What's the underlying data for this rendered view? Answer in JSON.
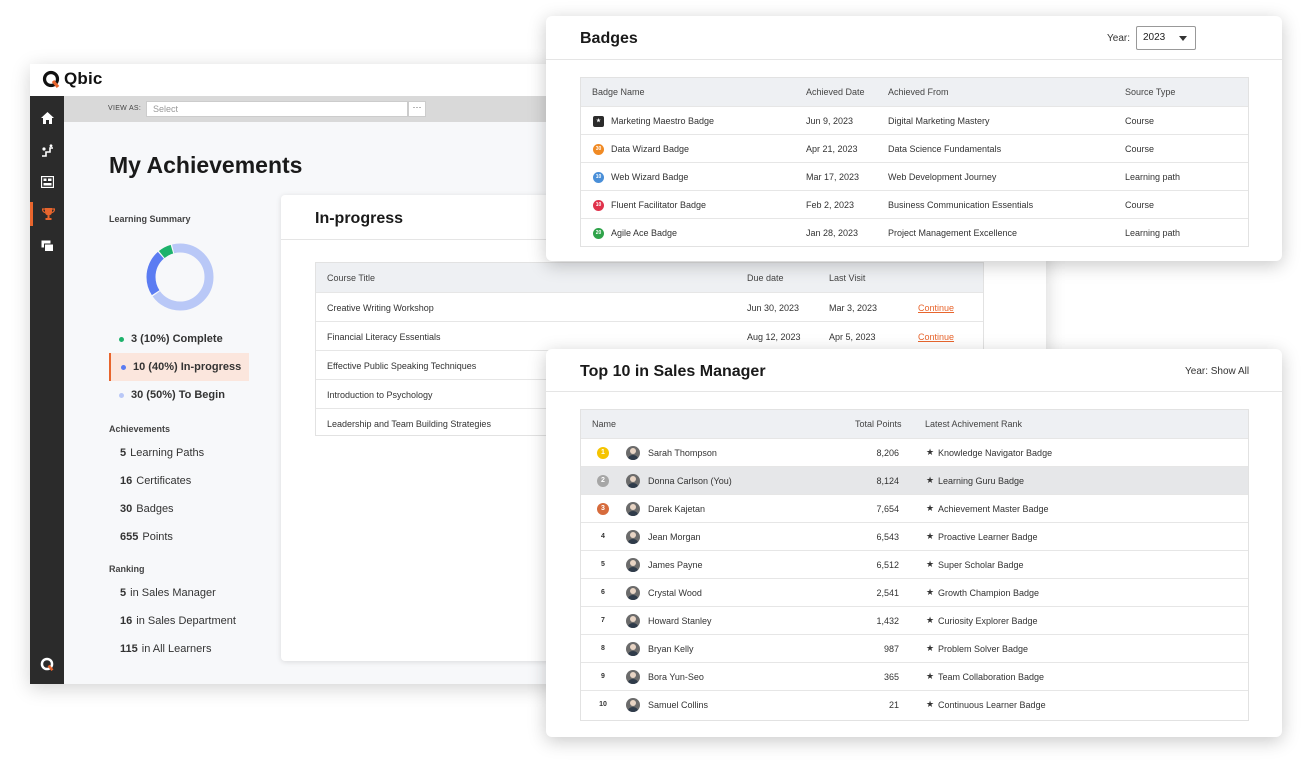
{
  "app": {
    "name": "Qbic"
  },
  "view_as": {
    "label": "VIEW AS:",
    "placeholder": "Select",
    "more": "···"
  },
  "page_title": "My Achievements",
  "summary": {
    "heading": "Learning Summary",
    "donut": [
      {
        "label": "Complete",
        "value": 3,
        "percent": "10%",
        "color": "#1db26b"
      },
      {
        "label": "In-progress",
        "value": 10,
        "percent": "40%",
        "color": "#5b7cf2"
      },
      {
        "label": "To Begin",
        "value": 30,
        "percent": "50%",
        "color": "#b9c8f7"
      }
    ],
    "legend": [
      {
        "text": "3 (10%)  Complete"
      },
      {
        "text": "10 (40%)  In-progress"
      },
      {
        "text": "30 (50%)  To Begin"
      }
    ]
  },
  "achievements": {
    "heading": "Achievements",
    "items": [
      {
        "num": "5",
        "label": "Learning Paths"
      },
      {
        "num": "16",
        "label": "Certificates"
      },
      {
        "num": "30",
        "label": "Badges"
      },
      {
        "num": "655",
        "label": "Points"
      }
    ]
  },
  "ranking": {
    "heading": "Ranking",
    "items": [
      {
        "num": "5",
        "label": "in Sales Manager"
      },
      {
        "num": "16",
        "label": "in Sales Department"
      },
      {
        "num": "115",
        "label": "in All Learners"
      }
    ]
  },
  "inprogress": {
    "title": "In-progress",
    "headers": [
      "Course Title",
      "Due date",
      "Last Visit"
    ],
    "rows": [
      {
        "title": "Creative Writing Workshop",
        "due": "Jun 30, 2023",
        "visit": "Mar 3, 2023",
        "action": "Continue"
      },
      {
        "title": "Financial Literacy Essentials",
        "due": "Aug 12, 2023",
        "visit": "Apr 5, 2023",
        "action": "Continue"
      },
      {
        "title": "Effective Public Speaking Techniques",
        "due": "",
        "visit": "",
        "action": ""
      },
      {
        "title": "Introduction to Psychology",
        "due": "",
        "visit": "",
        "action": ""
      },
      {
        "title": "Leadership and Team Building Strategies",
        "due": "",
        "visit": "",
        "action": ""
      }
    ]
  },
  "badges": {
    "title": "Badges",
    "year_label": "Year:",
    "year_value": "2023",
    "headers": [
      "Badge Name",
      "Achieved Date",
      "Achieved From",
      "Source Type"
    ],
    "rows": [
      {
        "icon": "star-badge",
        "color": "#2b2b2b",
        "mark": "★",
        "name": "Marketing Maestro Badge",
        "date": "Jun 9, 2023",
        "from": "Digital Marketing Mastery",
        "type": "Course"
      },
      {
        "icon": "30-badge",
        "color": "#f08a24",
        "mark": "30",
        "name": "Data Wizard Badge",
        "date": "Apr 21, 2023",
        "from": "Data Science Fundamentals",
        "type": "Course"
      },
      {
        "icon": "10-badge",
        "color": "#4a8fd8",
        "mark": "10",
        "name": "Web Wizard Badge",
        "date": "Mar 17, 2023",
        "from": "Web Development Journey",
        "type": "Learning path"
      },
      {
        "icon": "10-badge",
        "color": "#e0324b",
        "mark": "10",
        "name": "Fluent Facilitator Badge",
        "date": "Feb 2, 2023",
        "from": "Business Communication Essentials",
        "type": "Course"
      },
      {
        "icon": "20-badge",
        "color": "#2fa34a",
        "mark": "20",
        "name": "Agile Ace Badge",
        "date": "Jan 28, 2023",
        "from": "Project Management Excellence",
        "type": "Learning path"
      }
    ]
  },
  "top10": {
    "title": "Top 10 in Sales Manager",
    "year_text": "Year: Show All",
    "headers": [
      "Name",
      "Total Points",
      "Latest Achivement Rank"
    ],
    "rows": [
      {
        "rank": "1",
        "medal": "#f5c400",
        "name": "Sarah Thompson",
        "points": "8,206",
        "badge": "Knowledge Navigator Badge"
      },
      {
        "rank": "2",
        "medal": "#a6a6a6",
        "name": "Donna Carlson (You)",
        "points": "8,124",
        "badge": "Learning Guru Badge",
        "highlight": true
      },
      {
        "rank": "3",
        "medal": "#d66b3c",
        "name": "Darek Kajetan",
        "points": "7,654",
        "badge": "Achievement Master Badge"
      },
      {
        "rank": "4",
        "name": "Jean Morgan",
        "points": "6,543",
        "badge": "Proactive Learner Badge"
      },
      {
        "rank": "5",
        "name": "James Payne",
        "points": "6,512",
        "badge": "Super Scholar Badge"
      },
      {
        "rank": "6",
        "name": "Crystal Wood",
        "points": "2,541",
        "badge": "Growth Champion Badge"
      },
      {
        "rank": "7",
        "name": "Howard Stanley",
        "points": "1,432",
        "badge": "Curiosity Explorer Badge"
      },
      {
        "rank": "8",
        "name": "Bryan Kelly",
        "points": "987",
        "badge": "Problem Solver Badge"
      },
      {
        "rank": "9",
        "name": "Bora Yun-Seo",
        "points": "365",
        "badge": "Team Collaboration Badge"
      },
      {
        "rank": "10",
        "name": "Samuel Collins",
        "points": "21",
        "badge": "Continuous Learner Badge"
      }
    ]
  },
  "colors": {
    "accent": "#e8652d",
    "sidebar": "#2b2b2b"
  }
}
